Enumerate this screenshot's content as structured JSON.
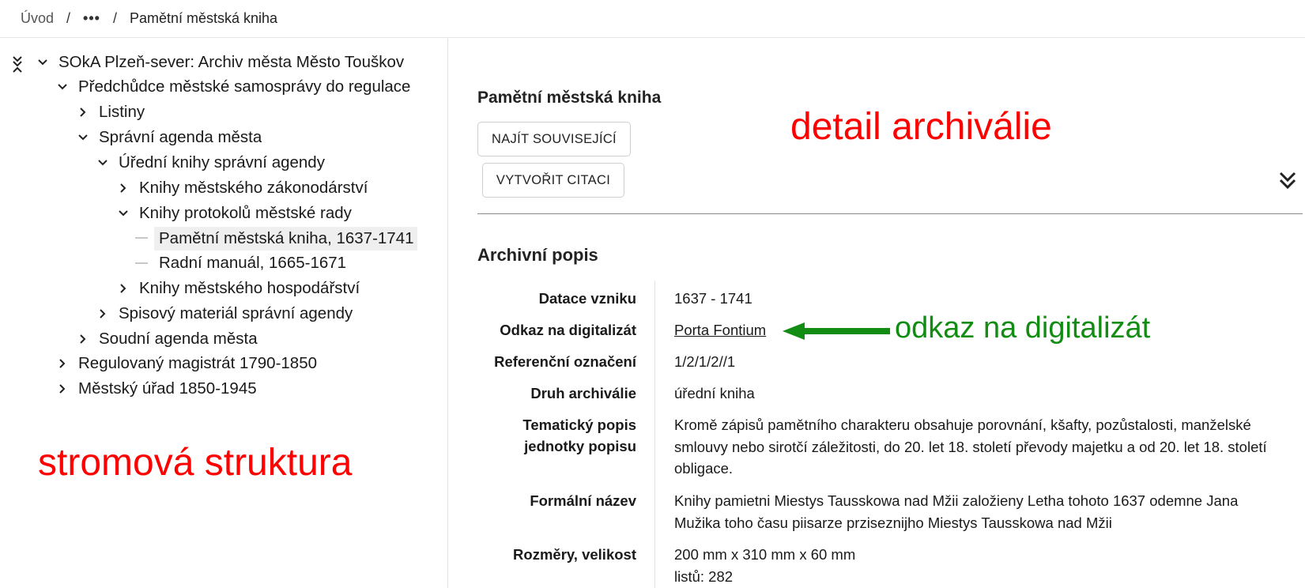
{
  "breadcrumb": {
    "home": "Úvod",
    "separator": "/",
    "ellipsis": "•••",
    "current": "Pamětní městská kniha"
  },
  "tree": {
    "items": [
      {
        "label": "SOkA Plzeň-sever: Archiv města Město Touškov",
        "toggle": "expanded"
      },
      {
        "label": "Předchůdce městské samosprávy do regulace",
        "toggle": "expanded"
      },
      {
        "label": "Listiny",
        "toggle": "collapsed"
      },
      {
        "label": "Správní agenda města",
        "toggle": "expanded"
      },
      {
        "label": "Úřední knihy správní agendy",
        "toggle": "expanded"
      },
      {
        "label": "Knihy městského zákonodárství",
        "toggle": "collapsed"
      },
      {
        "label": "Knihy protokolů městské rady",
        "toggle": "expanded"
      },
      {
        "label": "Pamětní městská kniha, 1637-1741",
        "toggle": "leaf",
        "selected": true
      },
      {
        "label": "Radní manuál, 1665-1671",
        "toggle": "leaf"
      },
      {
        "label": "Knihy městského hospodářství",
        "toggle": "collapsed"
      },
      {
        "label": "Spisový materiál správní agendy",
        "toggle": "collapsed"
      },
      {
        "label": "Soudní agenda města",
        "toggle": "collapsed"
      },
      {
        "label": "Regulovaný magistrát 1790-1850",
        "toggle": "collapsed"
      },
      {
        "label": "Městský úřad 1850-1945",
        "toggle": "collapsed"
      }
    ]
  },
  "annotations": {
    "tree": "stromová struktura",
    "detail": "detail archiválie",
    "digital_link": "odkaz na digitalizát"
  },
  "detail": {
    "title": "Pamětní městská kniha",
    "find_related": "NAJÍT SOUVISEJÍCÍ",
    "create_citation": "VYTVOŘIT CITACI",
    "section_title": "Archivní popis",
    "properties": {
      "dating_label": "Datace vzniku",
      "dating_value": "1637 - 1741",
      "digital_label": "Odkaz na digitalizát",
      "digital_value": "Porta Fontium",
      "ref_label": "Referenční označení",
      "ref_value": "1/2/1/2//1",
      "type_label": "Druh archiválie",
      "type_value": "úřední kniha",
      "topic_label_1": "Tematický popis",
      "topic_label_2": "jednotky popisu",
      "topic_value_1": "Kromě zápisů pamětního charakteru obsahuje porovnání, kšafty, pozůstalosti, manželské",
      "topic_value_2": "smlouvy nebo sirotčí záležitosti, do 20. let 18. století převody majetku a od 20. let 18. století",
      "topic_value_3": "obligace.",
      "formal_label": "Formální název",
      "formal_value_1": "Knihy pamietni Miestys Tausskowa nad Mžii založieny Letha tohoto 1637 odemne Jana",
      "formal_value_2": "Mužika toho času piisarze prziseznijho Miestys Tausskowa nad Mžii",
      "size_label": "Rozměry, velikost",
      "size_value_1": "200 mm x 310 mm x 60 mm",
      "size_value_2": "listů: 282"
    }
  },
  "colors": {
    "annotation_red": "#ff0000",
    "annotation_green": "#128c12"
  }
}
